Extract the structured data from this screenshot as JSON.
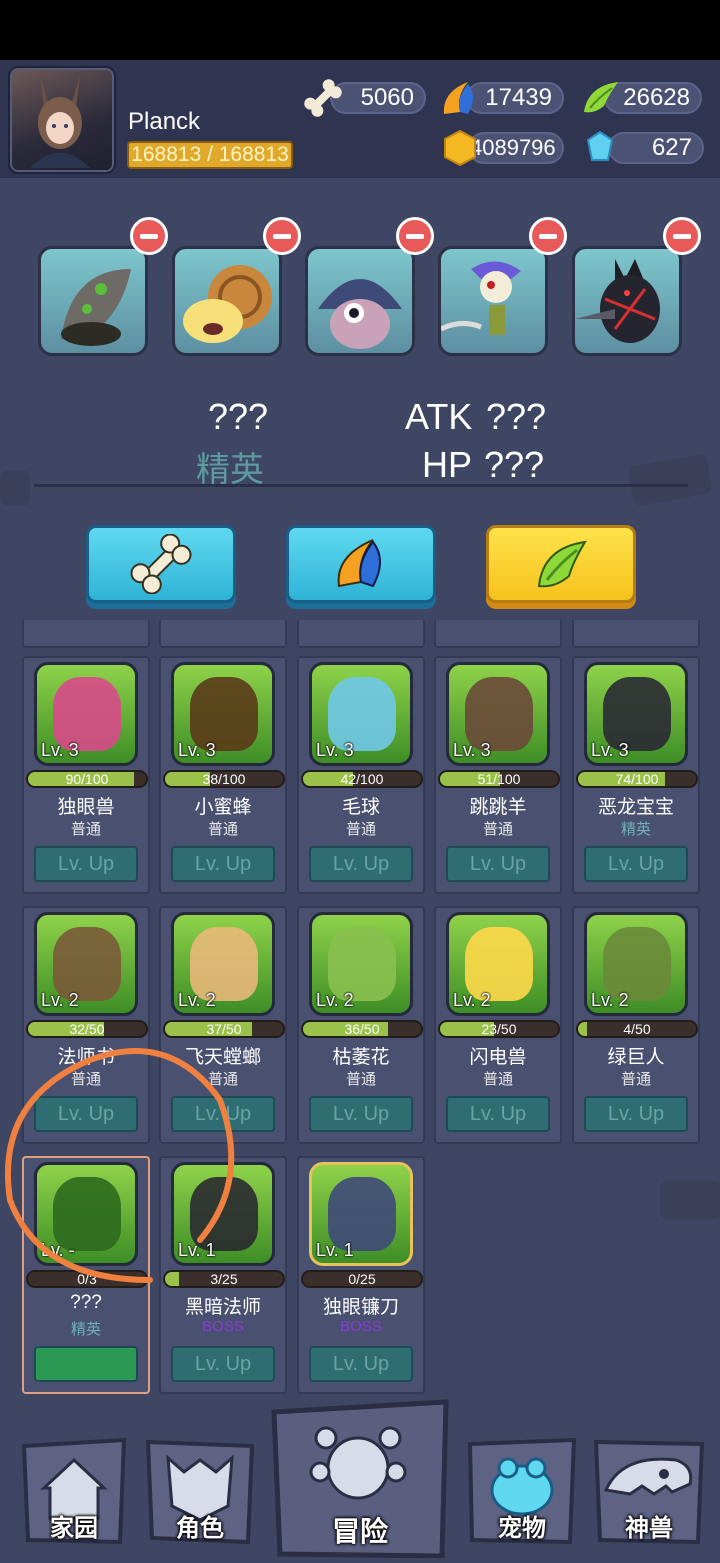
{
  "player": {
    "name": "Planck",
    "hp": "168813 / 168813"
  },
  "resources": {
    "bone": "5060",
    "claw": "17439",
    "leaf": "26628",
    "coin": "4089796",
    "gem": "627"
  },
  "team": [
    {
      "icon": "hermit-crab-monster"
    },
    {
      "icon": "snail-monster"
    },
    {
      "icon": "one-eyed-beetle-monster"
    },
    {
      "icon": "pirate-skeleton-monster"
    },
    {
      "icon": "dark-knight-monster"
    }
  ],
  "selected": {
    "name": "???",
    "rarity": "精英",
    "atk_label": "ATK",
    "atk_value": "???",
    "hp_label": "HP",
    "hp_value": "???"
  },
  "tabs": [
    {
      "icon": "bone-icon",
      "active": false
    },
    {
      "icon": "claw-icon",
      "active": false
    },
    {
      "icon": "leaf-icon",
      "active": true
    }
  ],
  "cards": [
    {
      "level": "Lv. 3",
      "progress": "90/100",
      "fill": 0.9,
      "name": "独眼兽",
      "rarity": "普通",
      "action": "Lv. Up"
    },
    {
      "level": "Lv. 3",
      "progress": "38/100",
      "fill": 0.38,
      "name": "小蜜蜂",
      "rarity": "普通",
      "action": "Lv. Up"
    },
    {
      "level": "Lv. 3",
      "progress": "42/100",
      "fill": 0.42,
      "name": "毛球",
      "rarity": "普通",
      "action": "Lv. Up"
    },
    {
      "level": "Lv. 3",
      "progress": "51/100",
      "fill": 0.51,
      "name": "跳跳羊",
      "rarity": "普通",
      "action": "Lv. Up"
    },
    {
      "level": "Lv. 3",
      "progress": "74/100",
      "fill": 0.74,
      "name": "恶龙宝宝",
      "rarity": "精英",
      "action": "Lv. Up"
    },
    {
      "level": "Lv. 2",
      "progress": "32/50",
      "fill": 0.64,
      "name": "法师书",
      "rarity": "普通",
      "action": "Lv. Up"
    },
    {
      "level": "Lv. 2",
      "progress": "37/50",
      "fill": 0.74,
      "name": "飞天螳螂",
      "rarity": "普通",
      "action": "Lv. Up"
    },
    {
      "level": "Lv. 2",
      "progress": "36/50",
      "fill": 0.72,
      "name": "枯萎花",
      "rarity": "普通",
      "action": "Lv. Up"
    },
    {
      "level": "Lv. 2",
      "progress": "23/50",
      "fill": 0.46,
      "name": "闪电兽",
      "rarity": "普通",
      "action": "Lv. Up"
    },
    {
      "level": "Lv. 2",
      "progress": "4/50",
      "fill": 0.08,
      "name": "绿巨人",
      "rarity": "普通",
      "action": "Lv. Up"
    },
    {
      "level": "Lv. -",
      "progress": "0/3",
      "fill": 0,
      "name": "???",
      "rarity": "精英",
      "action": ""
    },
    {
      "level": "Lv. 1",
      "progress": "3/25",
      "fill": 0.12,
      "name": "黑暗法师",
      "rarity": "BOSS",
      "action": "Lv. Up"
    },
    {
      "level": "Lv. 1",
      "progress": "0/25",
      "fill": 0,
      "name": "独眼镰刀",
      "rarity": "BOSS",
      "action": "Lv. Up"
    }
  ],
  "nav": [
    {
      "label": "家园",
      "icon": "home-icon"
    },
    {
      "label": "角色",
      "icon": "mask-icon"
    },
    {
      "label": "冒险",
      "icon": "paw-icon"
    },
    {
      "label": "宠物",
      "icon": "frog-icon"
    },
    {
      "label": "神兽",
      "icon": "dino-skull-icon"
    }
  ],
  "colors": {
    "common": "#e8e8e8",
    "elite": "#6fb0b8",
    "boss": "#8a3ad8",
    "annotation": "#f08040"
  }
}
